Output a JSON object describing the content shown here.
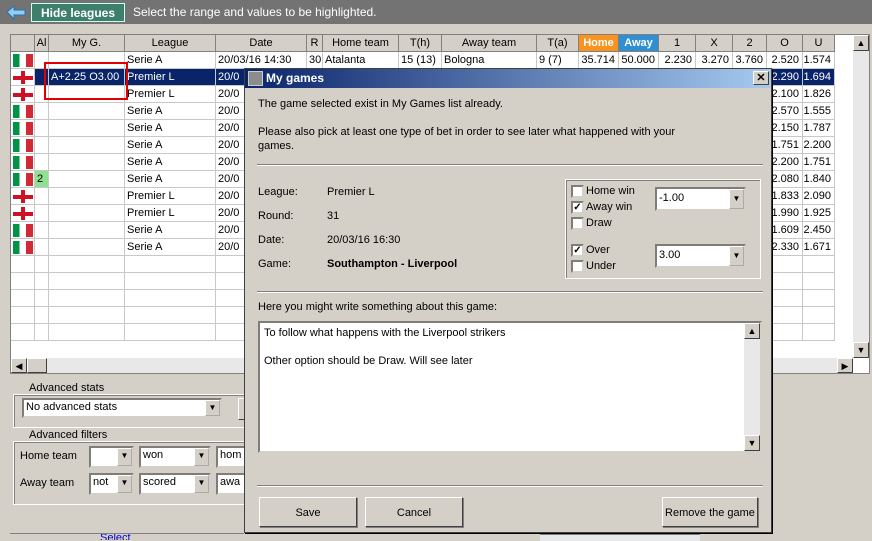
{
  "topbar": {
    "hide_leagues": "Hide leagues",
    "hint": "Select the range and values to be highlighted."
  },
  "table": {
    "headers": [
      "Al",
      "My G.",
      "League",
      "Date",
      "R",
      "Home team",
      "T(h)",
      "Away team",
      "T(a)",
      "Home",
      "Away",
      "1",
      "X",
      "2",
      "O",
      "U"
    ],
    "rows": [
      {
        "flag": "it",
        "al": "",
        "myg": "",
        "league": "Serie A",
        "date": "20/03/16 14:30",
        "r": "30",
        "home": "Atalanta",
        "th": "15 (13)",
        "away": "Bologna",
        "ta": "9 (7)",
        "hp": "35.714",
        "ap": "50.000",
        "o1": "2.230",
        "ox": "3.270",
        "o2": "3.760",
        "oo": "2.520",
        "ou": "1.574"
      },
      {
        "flag": "en",
        "al": "",
        "myg": "A+2.25 O3.00",
        "league": "Premier L",
        "date": "20/0",
        "o2": "",
        "oo": "2.290",
        "ou": "1.694",
        "selected": true
      },
      {
        "flag": "en",
        "league": "Premier L",
        "date": "20/0",
        "o2": "0",
        "oo": "2.100",
        "ou": "1.826"
      },
      {
        "flag": "it",
        "league": "Serie A",
        "date": "20/0",
        "o2": "4",
        "oo": "2.570",
        "ou": "1.555"
      },
      {
        "flag": "it",
        "league": "Serie A",
        "date": "20/0",
        "o2": "0",
        "oo": "2.150",
        "ou": "1.787"
      },
      {
        "flag": "it",
        "league": "Serie A",
        "date": "20/0",
        "o2": "8",
        "oo": "1.751",
        "ou": "2.200"
      },
      {
        "flag": "it",
        "league": "Serie A",
        "date": "20/0",
        "o2": "0",
        "oo": "2.200",
        "ou": "1.751"
      },
      {
        "flag": "it",
        "al": "2",
        "league": "Serie A",
        "date": "20/0",
        "o2": "0",
        "oo": "2.080",
        "ou": "1.840"
      },
      {
        "flag": "en",
        "league": "Premier L",
        "date": "20/0",
        "o2": "0",
        "oo": "1.833",
        "ou": "2.090"
      },
      {
        "flag": "en",
        "league": "Premier L",
        "date": "20/0",
        "o2": "0",
        "oo": "1.990",
        "ou": "1.925"
      },
      {
        "flag": "it",
        "league": "Serie A",
        "date": "20/0",
        "o2": "0",
        "oo": "1.609",
        "ou": "2.450"
      },
      {
        "flag": "it",
        "league": "Serie A",
        "date": "20/0",
        "o2": "0",
        "oo": "2.330",
        "ou": "1.671"
      }
    ]
  },
  "advanced_stats": {
    "label": "Advanced stats",
    "value": "No advanced stats"
  },
  "advanced_filters": {
    "label": "Advanced filters",
    "home_label": "Home team",
    "home_sel1": "",
    "home_sel2": "won",
    "home_sel3": "hom",
    "away_label": "Away team",
    "away_sel1": "not",
    "away_sel2": "scored",
    "away_sel3": "awa"
  },
  "bottom_link": "Select",
  "dialog": {
    "title": "My games",
    "msg1": "The game selected exist in My Games list already.",
    "msg2a": "Please also pick at least one  type of bet in order to see later what happened with your",
    "msg2b": "games.",
    "league_label": "League:",
    "league_value": "Premier L",
    "round_label": "Round:",
    "round_value": "31",
    "date_label": "Date:",
    "date_value": "20/03/16 16:30",
    "game_label": "Game:",
    "game_value": "Southampton - Liverpool",
    "home_win": "Home win",
    "away_win": "Away win",
    "draw": "Draw",
    "handicap_value": "-1.00",
    "over": "Over",
    "under": "Under",
    "ou_value": "3.00",
    "notes_label": "Here you might write something about this game:",
    "notes_line1": "To follow  what happens with the Liverpool strikers",
    "notes_line2": "Other option should be Draw. Will see later",
    "save": "Save",
    "cancel": "Cancel",
    "remove": "Remove the game",
    "checks": {
      "home_win": false,
      "away_win": true,
      "draw": false,
      "over": true,
      "under": false
    }
  },
  "colors": {
    "home_header": "#f7931e",
    "away_header": "#2f8fd0",
    "selected_row": "#0a246a",
    "highlight_box": "#e00000"
  }
}
